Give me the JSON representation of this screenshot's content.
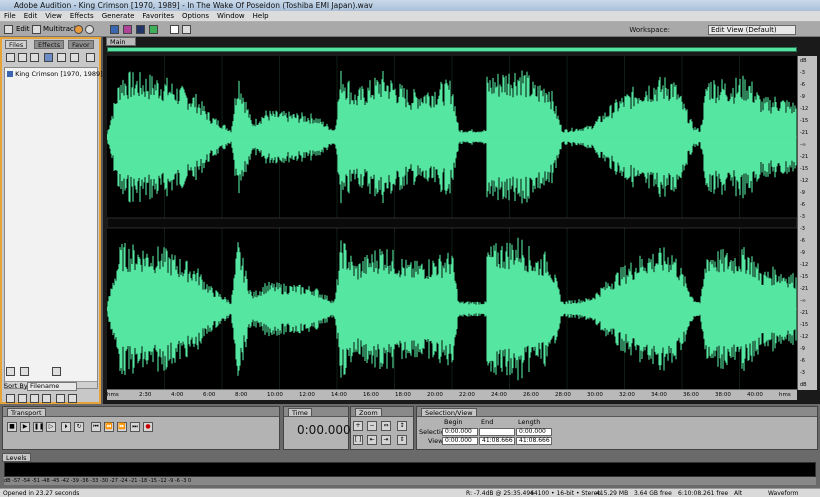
{
  "titlebar": {
    "title": "Adobe Audition - King Crimson [1970, 1989] - In The Wake Of Poseidon (Toshiba EMI Japan).wav"
  },
  "menu": [
    "File",
    "Edit",
    "View",
    "Effects",
    "Generate",
    "Favorites",
    "Options",
    "Window",
    "Help"
  ],
  "toolbar": {
    "edit_label": "Edit",
    "multitrack_label": "Multitrack",
    "workspace_label": "Workspace:",
    "workspace_value": "Edit View (Default)"
  },
  "left_panel": {
    "tabs": [
      "Files",
      "Effects",
      "Favor"
    ],
    "file_item": "King Crimson [1970, 1989] - In Th",
    "sort_by_label": "Sort By:",
    "sort_by_value": "Filename"
  },
  "main": {
    "tab_label": "Main",
    "wave_color": "#55e6a1",
    "time_ticks": [
      "hms",
      "2:30",
      "4:00",
      "6:00",
      "8:00",
      "10:00",
      "12:00",
      "14:00",
      "16:00",
      "18:00",
      "20:00",
      "22:00",
      "24:00",
      "26:00",
      "28:00",
      "30:00",
      "32:00",
      "34:00",
      "36:00",
      "38:00",
      "40:00",
      "hms"
    ],
    "amp_ticks_top": [
      "dB",
      "-3",
      "-6",
      "-9",
      "-12",
      "-15",
      "-21",
      "-∞",
      "-21",
      "-15",
      "-12",
      "-9",
      "-6",
      "-3"
    ],
    "amp_ticks_bottom": [
      "-3",
      "-6",
      "-9",
      "-12",
      "-15",
      "-21",
      "-∞",
      "-21",
      "-15",
      "-12",
      "-9",
      "-6",
      "-3",
      "dB"
    ]
  },
  "transport": {
    "tab_label": "Transport"
  },
  "time": {
    "tab_label": "Time",
    "value": "0:00.000"
  },
  "zoom": {
    "tab_label": "Zoom"
  },
  "selection_view": {
    "tab_label": "Selection/View",
    "col_begin": "Begin",
    "col_end": "End",
    "col_length": "Length",
    "row_selection": "Selection",
    "row_view": "View",
    "sel_begin": "0:00.000",
    "sel_end": "",
    "sel_length": "0:00.000",
    "view_begin": "0:00.000",
    "view_end": "41:08.666",
    "view_length": "41:08.666"
  },
  "levels": {
    "tab_label": "Levels",
    "ticks": "dB -57 -54 -51 -48 -45 -42 -39 -36 -33 -30 -27 -24 -21 -18 -15 -12 -9 -6 -3 0"
  },
  "status": {
    "left": "Opened in 23.27 seconds",
    "r": "R: -7.4dB @ 25:35.496",
    "format": "44100 • 16-bit • Stereo",
    "size": "415.29 MB",
    "free": "3.64 GB free",
    "time_free": "6:10:08.261 free",
    "alt": "Alt",
    "view": "Waveform"
  }
}
